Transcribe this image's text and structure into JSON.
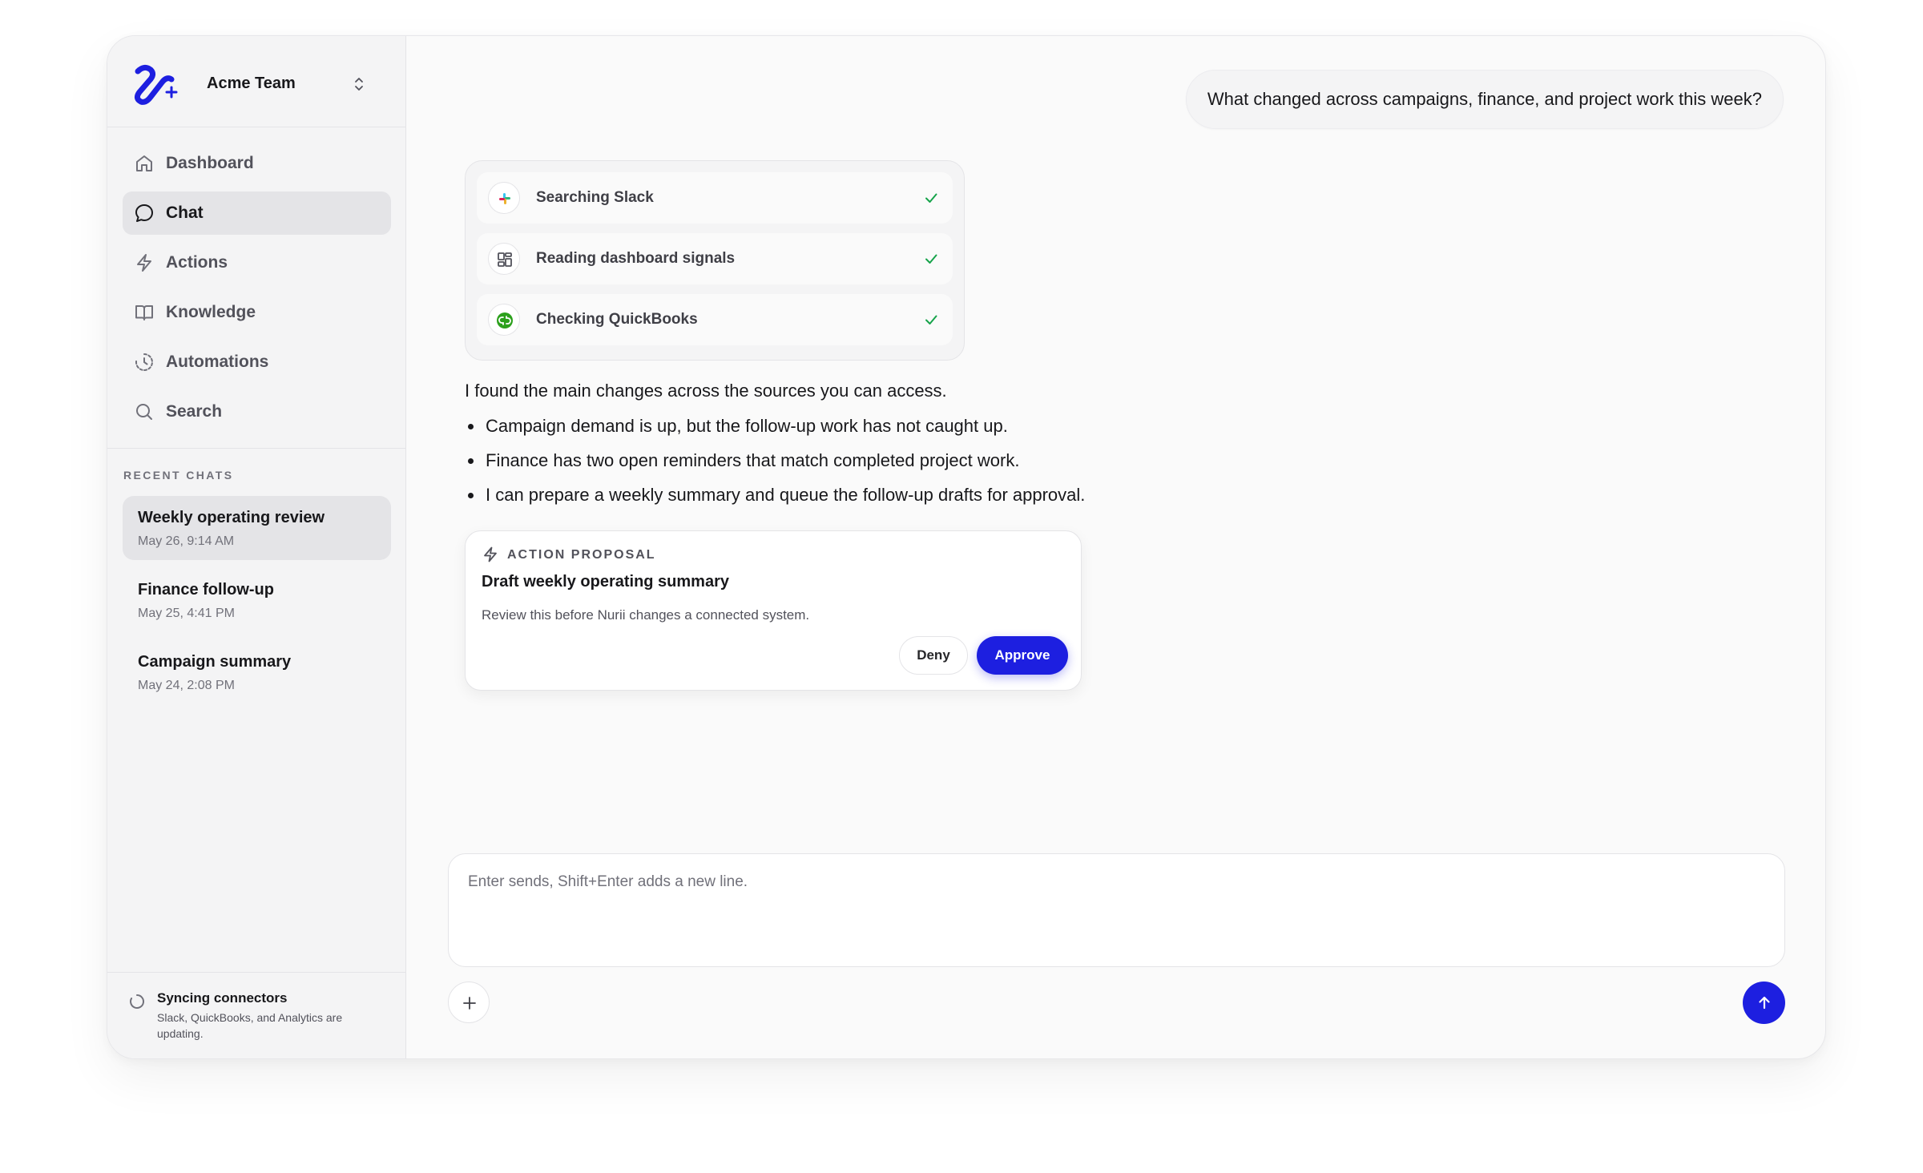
{
  "brand": {
    "accent": "#1d1fe0",
    "team_name": "Acme Team"
  },
  "nav": [
    {
      "label": "Dashboard",
      "icon": "home-icon",
      "active": false
    },
    {
      "label": "Chat",
      "icon": "chat-bubble-icon",
      "active": true
    },
    {
      "label": "Actions",
      "icon": "lightning-icon",
      "active": false
    },
    {
      "label": "Knowledge",
      "icon": "book-icon",
      "active": false
    },
    {
      "label": "Automations",
      "icon": "clock-refresh-icon",
      "active": false
    },
    {
      "label": "Search",
      "icon": "search-icon",
      "active": false
    }
  ],
  "recent": {
    "title": "RECENT CHATS",
    "items": [
      {
        "title": "Weekly operating review",
        "date": "May 26, 9:14 AM",
        "active": true
      },
      {
        "title": "Finance follow-up",
        "date": "May 25, 4:41 PM",
        "active": false
      },
      {
        "title": "Campaign summary",
        "date": "May 24, 2:08 PM",
        "active": false
      }
    ]
  },
  "sync": {
    "title": "Syncing connectors",
    "detail": "Slack, QuickBooks, and Analytics are updating."
  },
  "conversation": {
    "user_message": "What changed across campaigns, finance, and project work this week?",
    "tools": [
      {
        "label": "Searching Slack",
        "icon": "slack-icon",
        "status": "done"
      },
      {
        "label": "Reading dashboard signals",
        "icon": "dashboard-grid-icon",
        "status": "done"
      },
      {
        "label": "Checking QuickBooks",
        "icon": "quickbooks-icon",
        "status": "done"
      }
    ],
    "answer_intro": "I found the main changes across the sources you can access.",
    "bullets": [
      "Campaign demand is up, but the follow-up work has not caught up.",
      "Finance has two open reminders that match completed project work.",
      "I can prepare a weekly summary and queue the follow-up drafts for approval."
    ],
    "proposal": {
      "tag": "ACTION PROPOSAL",
      "title": "Draft weekly operating summary",
      "description": "Review this before Nurii changes a connected system.",
      "deny_label": "Deny",
      "approve_label": "Approve"
    }
  },
  "composer": {
    "placeholder": "Enter sends, Shift+Enter adds a new line.",
    "value": ""
  }
}
